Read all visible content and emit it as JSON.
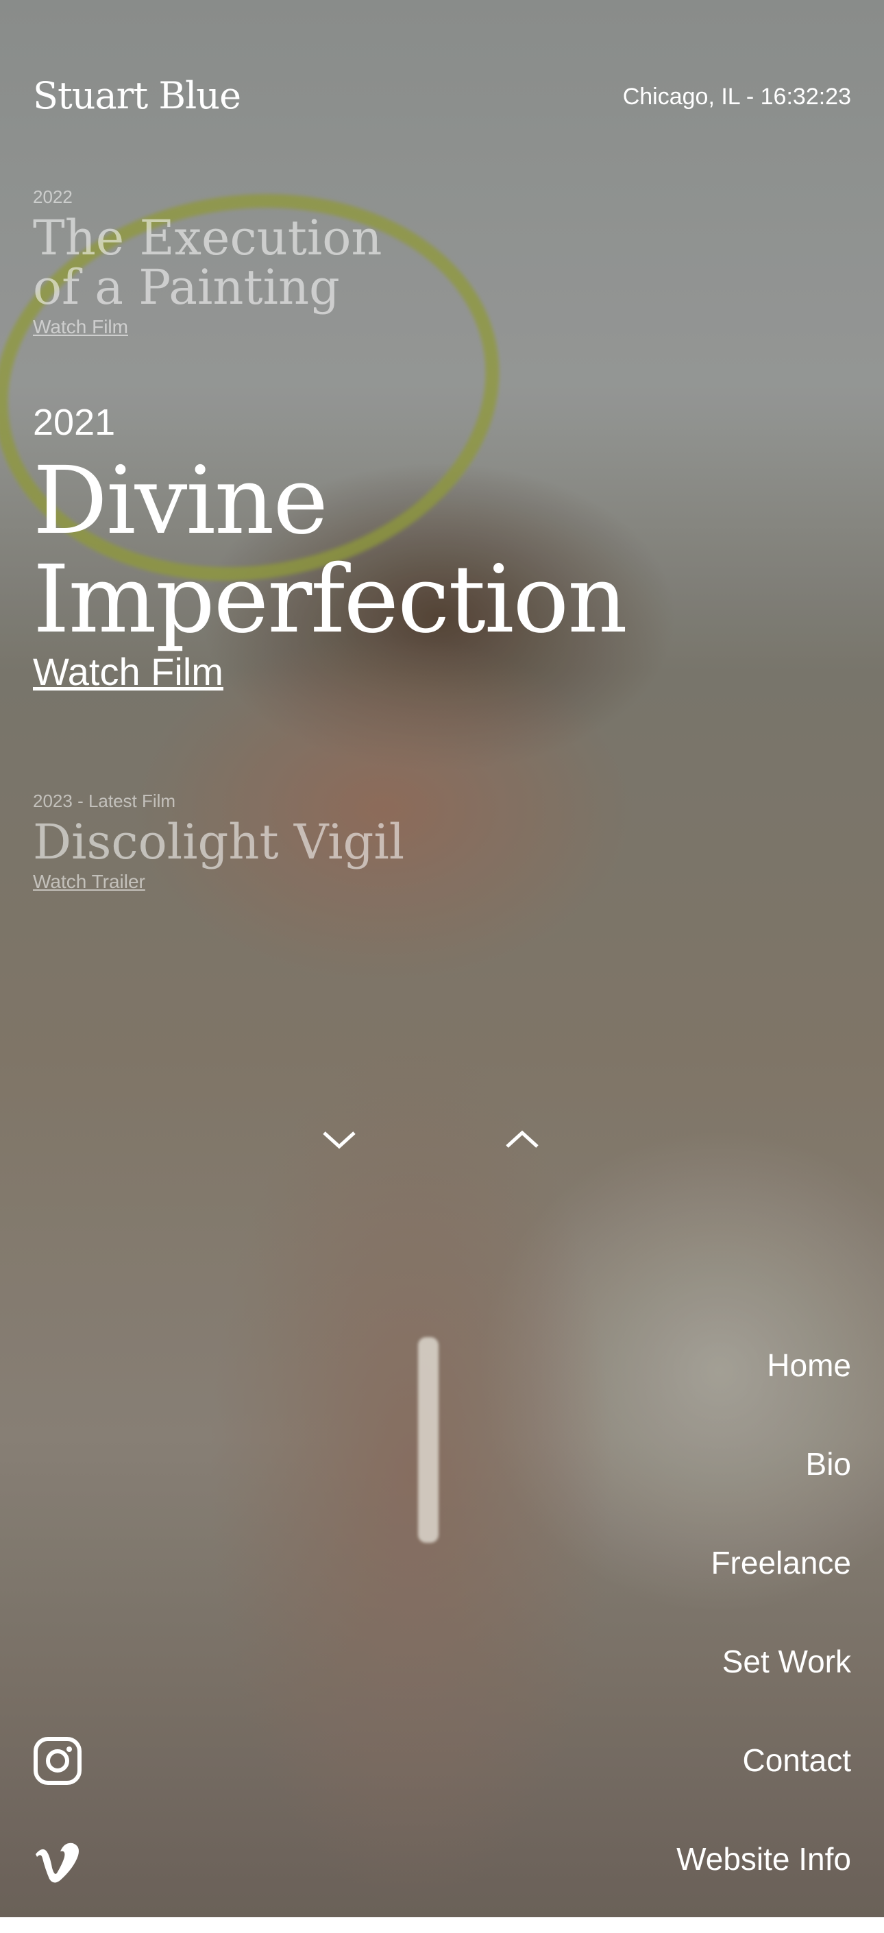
{
  "header": {
    "brand": "Stuart Blue",
    "location_time": "Chicago, IL - 16:32:23"
  },
  "films": [
    {
      "year": "2022",
      "title": "The Execution of a Painting",
      "link": "Watch Film"
    },
    {
      "year": "2021",
      "title": "Divine Imperfection",
      "link": "Watch Film"
    },
    {
      "year": "2023 - Latest Film",
      "title": "Discolight Vigil",
      "link": "Watch Trailer"
    }
  ],
  "controls": {
    "down_icon": "chevron-down-icon",
    "up_icon": "chevron-up-icon"
  },
  "nav": {
    "items": [
      {
        "label": "Home"
      },
      {
        "label": "Bio"
      },
      {
        "label": "Freelance"
      },
      {
        "label": "Set Work"
      },
      {
        "label": "Contact"
      },
      {
        "label": "Website Info"
      }
    ]
  },
  "social": {
    "instagram_icon": "instagram-icon",
    "vimeo_icon": "vimeo-icon"
  }
}
